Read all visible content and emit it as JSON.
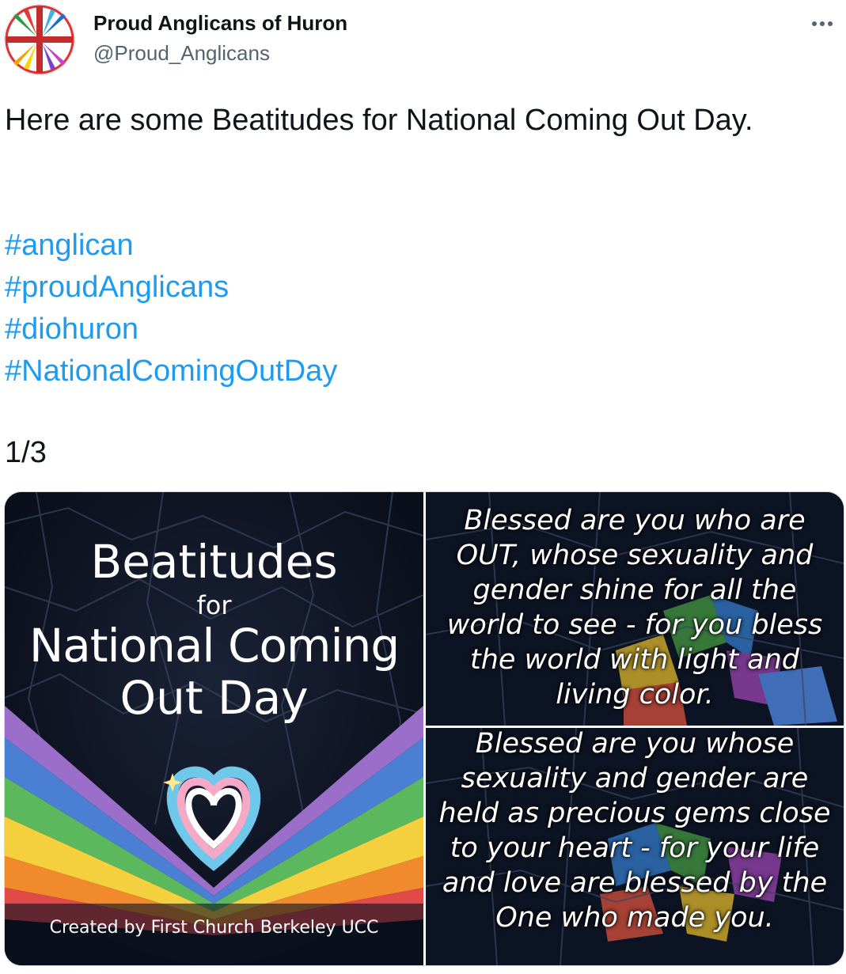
{
  "author": {
    "display_name": "Proud Anglicans of Huron",
    "handle": "@Proud_Anglicans",
    "avatar_icon": "rainbow-compass-rose-logo"
  },
  "more_icon": "more-horizontal-icon",
  "tweet": {
    "text_line": "Here are some Beatitudes for National Coming Out Day.",
    "hashtags": [
      "#anglican",
      "#proudAnglicans",
      "#diohuron",
      "#NationalComingOutDay"
    ],
    "counter": "1/3"
  },
  "media": {
    "image1": {
      "title_line1": "Beatitudes",
      "title_line2": "for",
      "title_line3": "National Coming",
      "title_line4": "Out Day",
      "credit": "Created by First Church Berkeley UCC"
    },
    "image2": {
      "text": "Blessed are you who are OUT, whose sexuality and gender shine for all the world to see - for you bless the world with light and living color."
    },
    "image3": {
      "text": "Blessed are you whose sexuality and gender are held as precious gems close to your heart - for your life and love are blessed by the One who made you."
    }
  },
  "colors": {
    "link": "#1d9bf0",
    "secondary_text": "#536471",
    "rainbow": [
      "#e24a4a",
      "#f08a2c",
      "#f4d03f",
      "#5cb85c",
      "#4a7fd4",
      "#9b6fc9"
    ]
  }
}
